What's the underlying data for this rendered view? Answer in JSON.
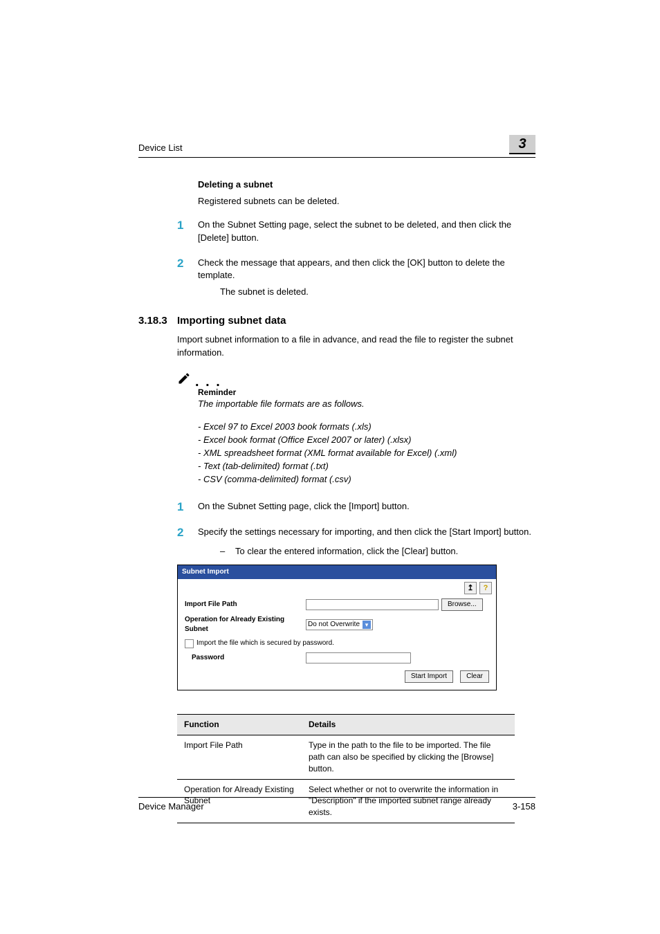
{
  "header": {
    "breadcrumb": "Device List",
    "chapter": "3"
  },
  "section_delete": {
    "heading": "Deleting a subnet",
    "intro": "Registered subnets can be deleted.",
    "steps": [
      {
        "n": "1",
        "text": "On the Subnet Setting page, select the subnet to be deleted, and then click the [Delete] button."
      },
      {
        "n": "2",
        "text": "Check the message that appears, and then click the [OK] button to delete the template."
      }
    ],
    "result": "The subnet is deleted."
  },
  "section_import": {
    "number": "3.18.3",
    "title": "Importing subnet data",
    "intro": "Import subnet information to a file in advance, and read the file to register the subnet information.",
    "reminder_label": "Reminder",
    "reminder_intro": "The importable file formats are as follows.",
    "reminder_items": [
      "- Excel 97 to Excel 2003 book formats (.xls)",
      "- Excel book format (Office Excel 2007 or later) (.xlsx)",
      "- XML spreadsheet format (XML format available for Excel) (.xml)",
      "- Text (tab-delimited) format (.txt)",
      "- CSV (comma-delimited) format (.csv)"
    ],
    "steps": [
      {
        "n": "1",
        "text": "On the Subnet Setting page, click the [Import] button."
      },
      {
        "n": "2",
        "text": "Specify the settings necessary for importing, and then click the [Start Import] button."
      }
    ],
    "sub_bullet": "To clear the entered information, click the [Clear] button."
  },
  "screenshot": {
    "title": "Subnet Import",
    "back_icon": "↥",
    "help_icon": "?",
    "import_file_path_label": "Import File Path",
    "browse_label": "Browse...",
    "operation_label": "Operation for Already Existing Subnet",
    "operation_value": "Do not Overwrite",
    "import_secure_label": "Import the file which is secured by password.",
    "password_label": "Password",
    "start_import_label": "Start Import",
    "clear_label": "Clear"
  },
  "fn_table": {
    "headers": {
      "c1": "Function",
      "c2": "Details"
    },
    "rows": [
      {
        "c1": "Import File Path",
        "c2": "Type in the path to the file to be imported. The file path can also be specified by clicking the [Browse] button."
      },
      {
        "c1": "Operation for Already Existing Subnet",
        "c2": "Select whether or not to overwrite the information in \"Description\" if the imported subnet range already exists."
      }
    ]
  },
  "footer": {
    "left": "Device Manager",
    "right": "3-158"
  }
}
